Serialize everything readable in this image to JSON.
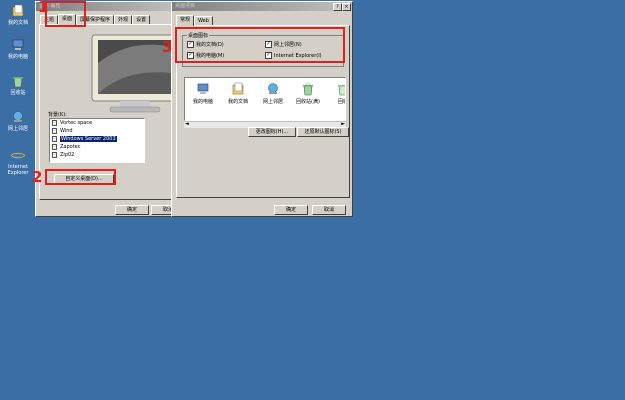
{
  "desktop": {
    "icons": [
      {
        "label": "我的文档",
        "icon": "my-documents-icon"
      },
      {
        "label": "我的电脑",
        "icon": "my-computer-icon"
      },
      {
        "label": "回收站",
        "icon": "recycle-bin-icon"
      },
      {
        "label": "网上邻居",
        "icon": "network-places-icon"
      },
      {
        "label": "Internet Explorer",
        "icon": "internet-explorer-icon"
      }
    ]
  },
  "display_props": {
    "title": "显示 属性",
    "help_btn": "?",
    "close_btn": "×",
    "tabs": [
      "主题",
      "桌面",
      "屏幕保护程序",
      "外观",
      "设置"
    ],
    "background_label": "背景(K):",
    "backgrounds": [
      "Vortec space",
      "Wind",
      "Windows Server 2003",
      "Zapotec",
      "Zip02"
    ],
    "selected_background": "Windows Server 2003",
    "customize_button": "自定义桌面(D)...",
    "ok_button": "确定",
    "cancel_button": "取消"
  },
  "desktop_items": {
    "title": "桌面项目",
    "help_btn": "?",
    "close_btn": "×",
    "tabs": [
      "常规",
      "Web"
    ],
    "group_label": "桌面图标",
    "checkboxes": [
      {
        "label": "我的文档(D)",
        "checked": true
      },
      {
        "label": "网上邻居(N)",
        "checked": true
      },
      {
        "label": "我的电脑(M)",
        "checked": true
      },
      {
        "label": "Internet Explorer(I)",
        "checked": true
      }
    ],
    "preview_icons": [
      {
        "label": "我的电脑",
        "icon": "my-computer-icon"
      },
      {
        "label": "我的文档",
        "icon": "my-documents-icon"
      },
      {
        "label": "网上邻居",
        "icon": "network-places-icon"
      },
      {
        "label": "回收站(满)",
        "icon": "recycle-bin-full-icon"
      },
      {
        "label": "回收",
        "icon": "recycle-bin-empty-icon"
      }
    ],
    "change_icon_button": "更改图标(H)...",
    "restore_default_button": "还原默认图标(S)",
    "ok_button": "确定",
    "cancel_button": "取消"
  },
  "annotations": [
    "1",
    "2",
    "3"
  ],
  "colors": {
    "desktop": "#3a6ea5",
    "annotation": "#e0201c",
    "window": "#d4d0c8"
  }
}
